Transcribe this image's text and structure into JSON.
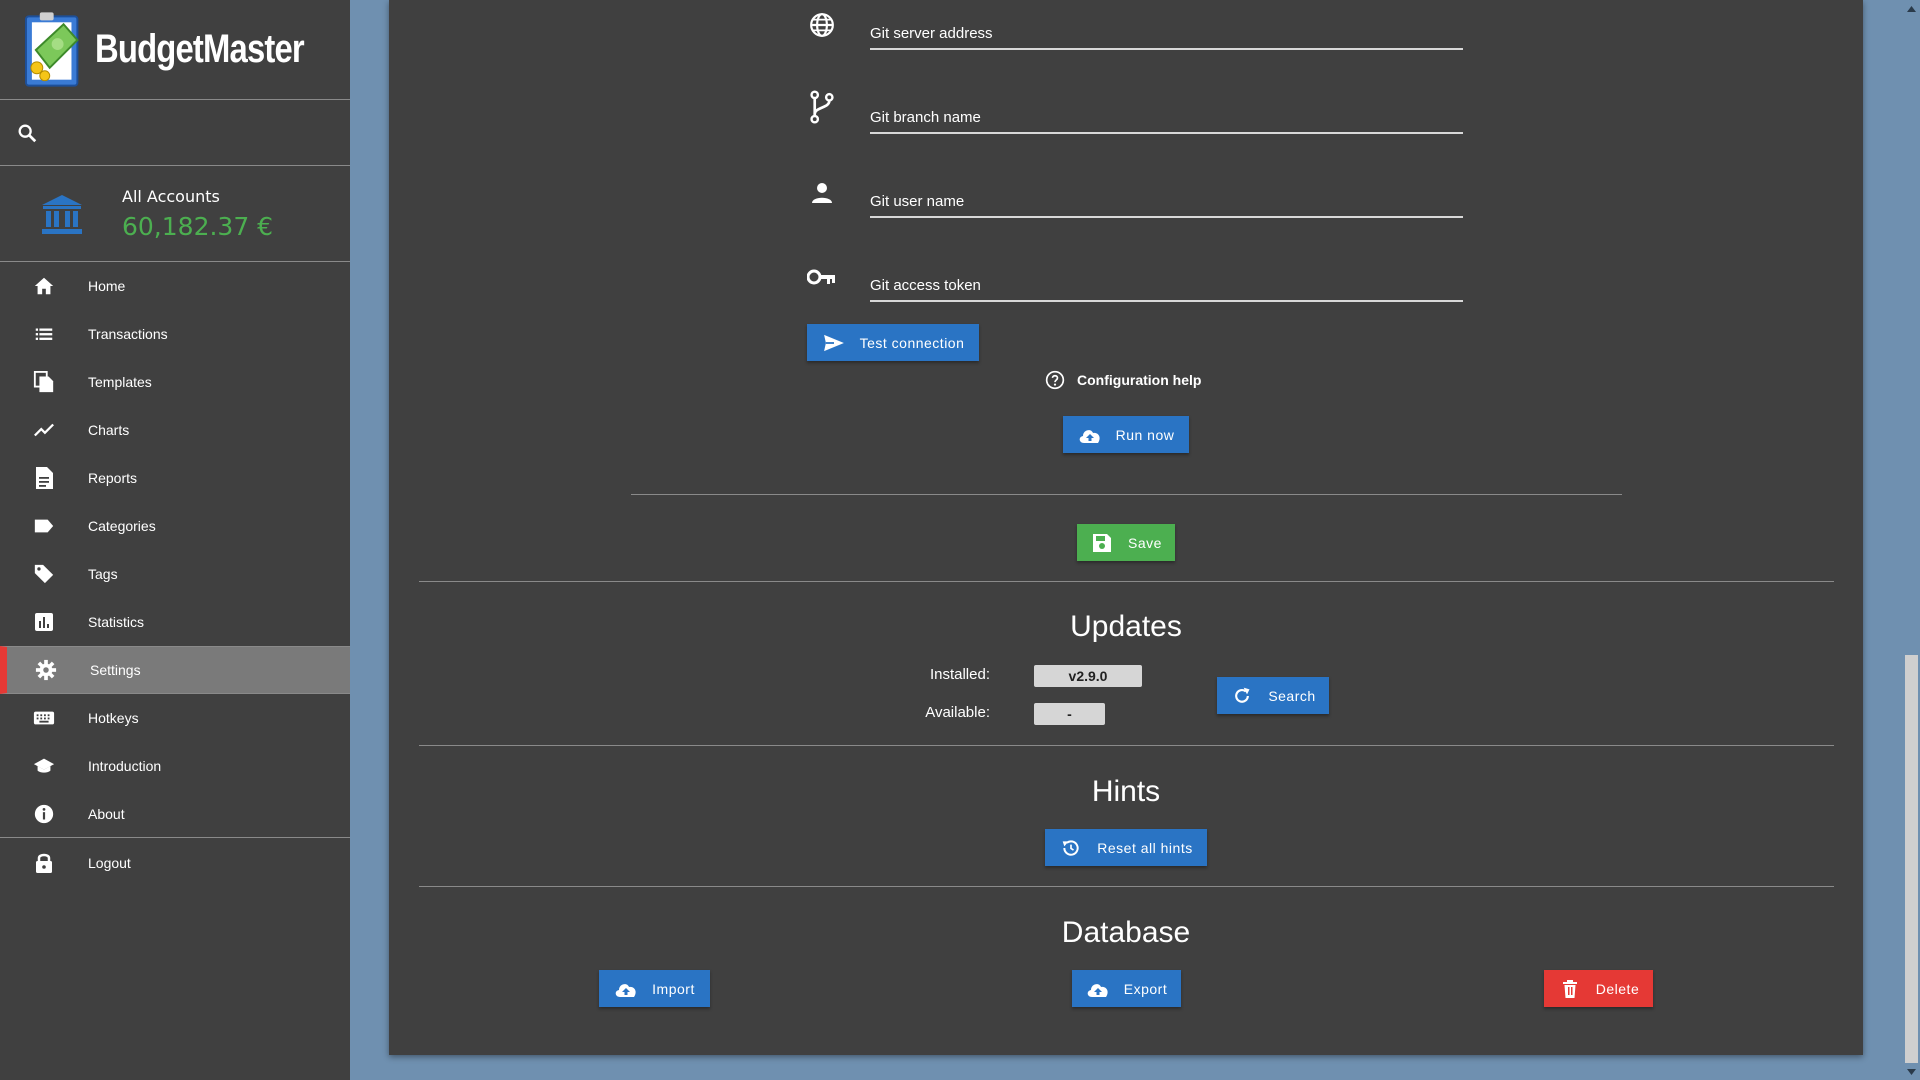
{
  "app": {
    "name": "BudgetMaster"
  },
  "account": {
    "name": "All Accounts",
    "balance": "60,182.37 €",
    "balance_color": "#4caf50"
  },
  "sidebar": {
    "items": [
      {
        "label": "Home",
        "icon": "home-icon"
      },
      {
        "label": "Transactions",
        "icon": "list-icon"
      },
      {
        "label": "Templates",
        "icon": "file-copy-icon"
      },
      {
        "label": "Charts",
        "icon": "line-chart-icon"
      },
      {
        "label": "Reports",
        "icon": "report-icon"
      },
      {
        "label": "Categories",
        "icon": "label-icon"
      },
      {
        "label": "Tags",
        "icon": "tag-icon"
      },
      {
        "label": "Statistics",
        "icon": "bar-chart-icon"
      },
      {
        "label": "Settings",
        "icon": "gear-icon",
        "active": true
      },
      {
        "label": "Hotkeys",
        "icon": "keyboard-icon"
      },
      {
        "label": "Introduction",
        "icon": "school-icon"
      },
      {
        "label": "About",
        "icon": "info-icon"
      },
      {
        "label": "Logout",
        "icon": "lock-icon"
      }
    ],
    "active_color": "#e53935"
  },
  "git": {
    "server_placeholder": "Git server address",
    "branch_placeholder": "Git branch name",
    "user_placeholder": "Git user name",
    "token_placeholder": "Git access token",
    "test_label": "Test connection",
    "help_label": "Configuration help",
    "run_label": "Run now"
  },
  "save_label": "Save",
  "updates": {
    "title": "Updates",
    "installed_label": "Installed:",
    "installed_value": "v2.9.0",
    "available_label": "Available:",
    "available_value": "-",
    "search_label": "Search"
  },
  "hints": {
    "title": "Hints",
    "reset_label": "Reset all hints"
  },
  "database": {
    "title": "Database",
    "import_label": "Import",
    "export_label": "Export",
    "delete_label": "Delete"
  },
  "colors": {
    "primary": "#2a74c4",
    "success": "#4caf50",
    "danger": "#e53935",
    "background": "#6f90b0",
    "card": "#404040"
  }
}
